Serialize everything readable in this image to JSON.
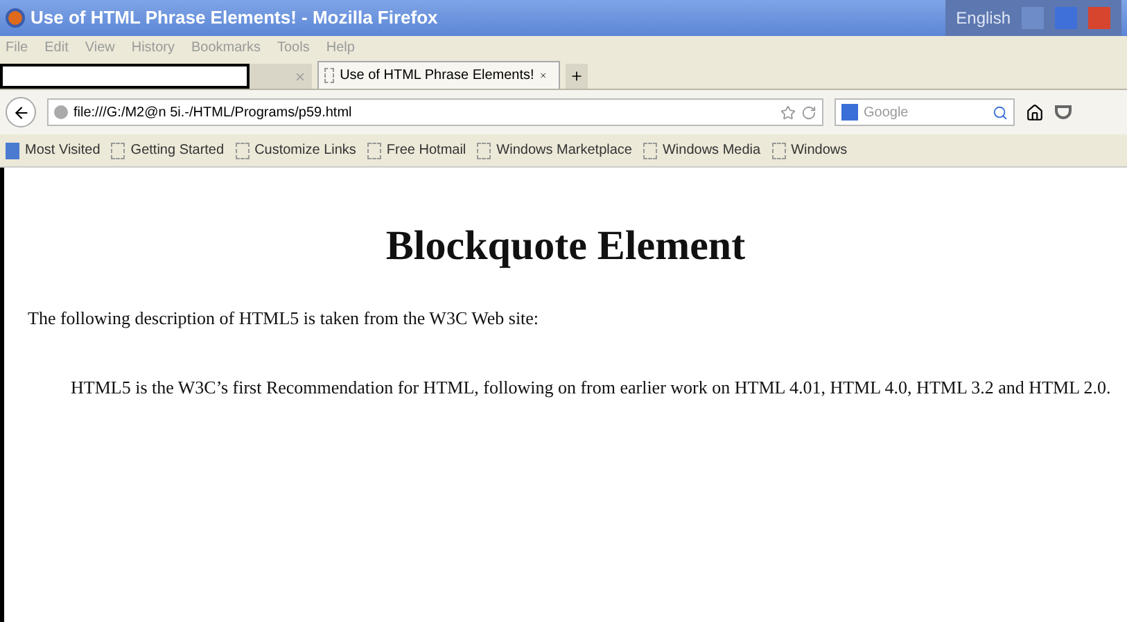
{
  "window": {
    "title": "Use of HTML Phrase Elements! - Mozilla Firefox",
    "language": "English"
  },
  "menu": [
    "File",
    "Edit",
    "View",
    "History",
    "Bookmarks",
    "Tools",
    "Help"
  ],
  "tabs": [
    {
      "selected": false
    },
    {
      "label": "Use of HTML Phrase Elements!",
      "selected": true
    }
  ],
  "url": "file:///G:/M2@n 5i.-/HTML/Programs/p59.html",
  "search": {
    "placeholder": "Google"
  },
  "bookmarks": [
    "Most Visited",
    "Getting Started",
    "Customize Links",
    "Free Hotmail",
    "Windows Marketplace",
    "Windows Media",
    "Windows"
  ],
  "page": {
    "heading": "Blockquote Element",
    "intro": "The following description of HTML5 is taken from the W3C Web site:",
    "quote": "HTML5 is the W3C’s first Recommendation for HTML, following on from earlier work on HTML 4.01, HTML 4.0, HTML 3.2 and HTML 2.0."
  }
}
